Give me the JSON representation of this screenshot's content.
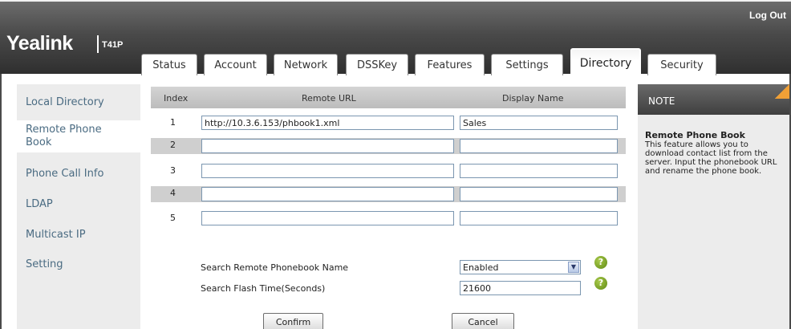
{
  "header": {
    "logo": "Yealink",
    "model": "T41P",
    "logout": "Log Out"
  },
  "tabs": [
    {
      "label": "Status"
    },
    {
      "label": "Account"
    },
    {
      "label": "Network"
    },
    {
      "label": "DSSKey"
    },
    {
      "label": "Features"
    },
    {
      "label": "Settings"
    },
    {
      "label": "Directory",
      "active": true
    },
    {
      "label": "Security"
    }
  ],
  "sidebar": {
    "items": [
      {
        "label": "Local Directory"
      },
      {
        "label": "Remote Phone Book",
        "active": true
      },
      {
        "label": "Phone Call Info"
      },
      {
        "label": "LDAP"
      },
      {
        "label": "Multicast IP"
      },
      {
        "label": "Setting"
      }
    ]
  },
  "table": {
    "headers": {
      "index": "Index",
      "url": "Remote URL",
      "name": "Display Name"
    },
    "rows": [
      {
        "index": "1",
        "url": "http://10.3.6.153/phbook1.xml",
        "name": "Sales"
      },
      {
        "index": "2",
        "url": "",
        "name": ""
      },
      {
        "index": "3",
        "url": "",
        "name": ""
      },
      {
        "index": "4",
        "url": "",
        "name": ""
      },
      {
        "index": "5",
        "url": "",
        "name": ""
      }
    ]
  },
  "settings": {
    "search_name_label": "Search Remote Phonebook Name",
    "search_name_value": "Enabled",
    "flash_time_label": "Search Flash Time(Seconds)",
    "flash_time_value": "21600"
  },
  "buttons": {
    "confirm": "Confirm",
    "cancel": "Cancel"
  },
  "note": {
    "title": "NOTE",
    "heading": "Remote Phone Book",
    "text": "This feature allows you to download contact list from the server. Input the phonebook URL and rename the phone book."
  },
  "colors": {
    "header_dark": "#2f2f2f",
    "sidebar_link": "#4a6b82",
    "help_icon": "#5f8a14",
    "note_accent": "#f0a036"
  }
}
